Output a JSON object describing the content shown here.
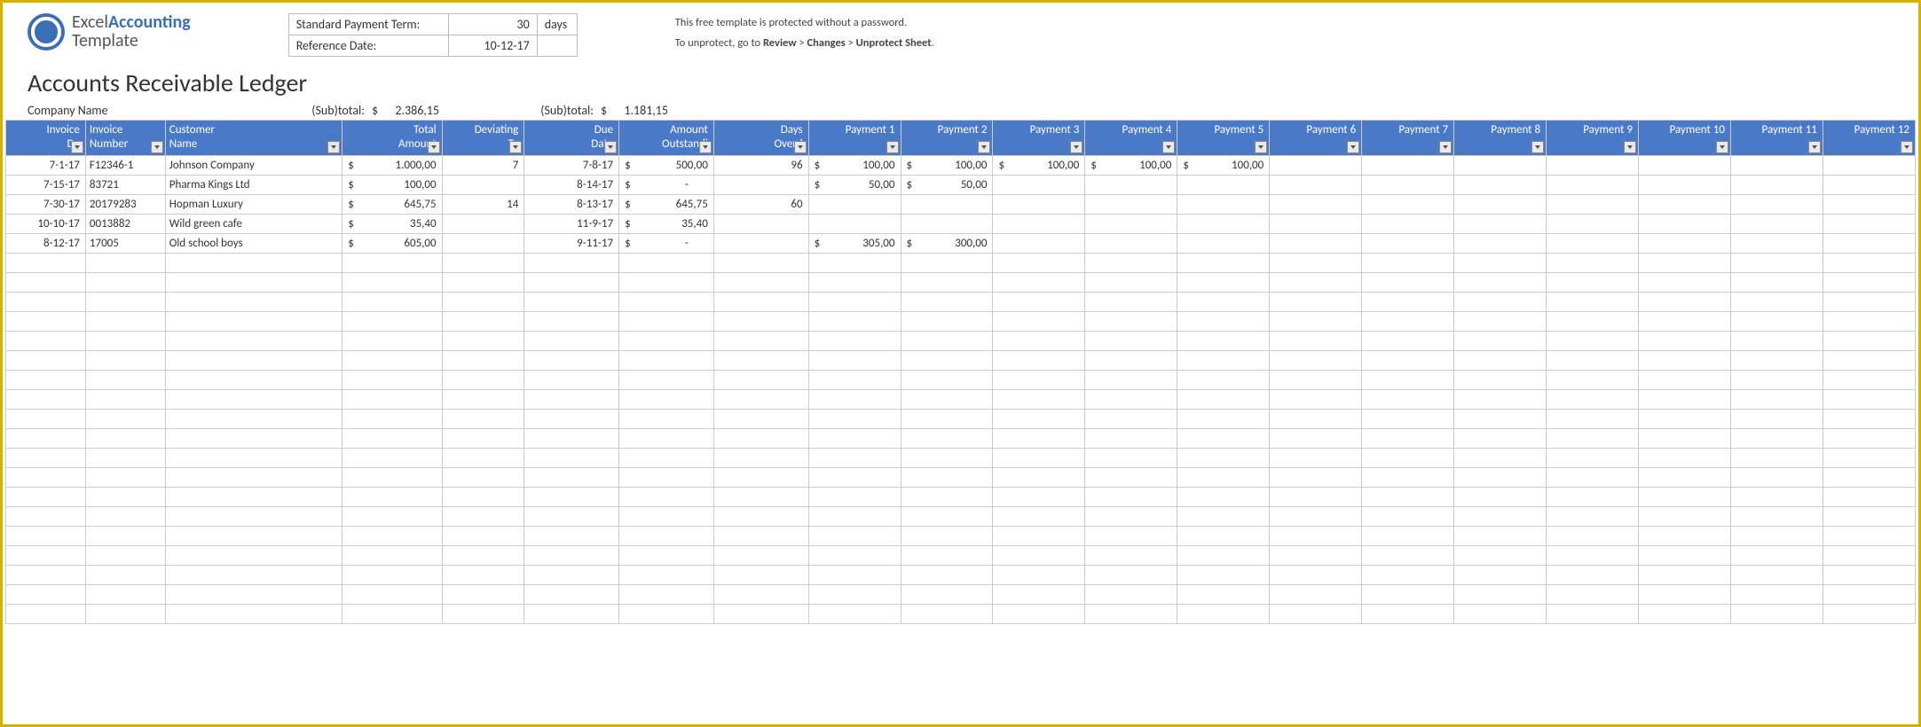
{
  "logo": {
    "line1a": "Excel",
    "line1b": "Accounting",
    "line2": "Template"
  },
  "params": {
    "term_label": "Standard Payment Term:",
    "term_value": "30",
    "term_unit": "days",
    "ref_label": "Reference Date:",
    "ref_value": "10-12-17"
  },
  "notice": {
    "line1": "This free template is protected without a password.",
    "line2a": "To unprotect, go to ",
    "b1": "Review",
    "sep": " > ",
    "b2": "Changes",
    "b3": "Unprotect Sheet",
    "period": "."
  },
  "title": "Accounts Receivable Ledger",
  "subtotals": {
    "company_label": "Company Name",
    "label1": "(Sub)total:",
    "cur1": "$",
    "val1": "2.386,15",
    "label2": "(Sub)total:",
    "cur2": "$",
    "val2": "1.181,15"
  },
  "columns": [
    "Invoice Da",
    "Invoice Number",
    "Customer Name",
    "Total Amount",
    "Deviating Te",
    "Due Date",
    "Amount Outstandi",
    "Days Overd",
    "Payment 1",
    "Payment 2",
    "Payment 3",
    "Payment 4",
    "Payment 5",
    "Payment 6",
    "Payment 7",
    "Payment 8",
    "Payment 9",
    "Payment 10",
    "Payment 11",
    "Payment 12"
  ],
  "currency": "$",
  "rows": [
    {
      "inv_date": "7-1-17",
      "inv_num": "F12346-1",
      "customer": "Johnson Company",
      "total": "1.000,00",
      "dev": "7",
      "due": "7-8-17",
      "amt_out": "500,00",
      "overdue": "96",
      "payments": [
        "100,00",
        "100,00",
        "100,00",
        "100,00",
        "100,00",
        "",
        "",
        "",
        "",
        "",
        "",
        ""
      ]
    },
    {
      "inv_date": "7-15-17",
      "inv_num": "83721",
      "customer": "Pharma Kings Ltd",
      "total": "100,00",
      "dev": "",
      "due": "8-14-17",
      "amt_out": "-",
      "overdue": "",
      "payments": [
        "50,00",
        "50,00",
        "",
        "",
        "",
        "",
        "",
        "",
        "",
        "",
        "",
        ""
      ]
    },
    {
      "inv_date": "7-30-17",
      "inv_num": "20179283",
      "customer": "Hopman Luxury",
      "total": "645,75",
      "dev": "14",
      "due": "8-13-17",
      "amt_out": "645,75",
      "overdue": "60",
      "payments": [
        "",
        "",
        "",
        "",
        "",
        "",
        "",
        "",
        "",
        "",
        "",
        ""
      ]
    },
    {
      "inv_date": "10-10-17",
      "inv_num": "0013882",
      "customer": "Wild green cafe",
      "total": "35,40",
      "dev": "",
      "due": "11-9-17",
      "amt_out": "35,40",
      "overdue": "",
      "payments": [
        "",
        "",
        "",
        "",
        "",
        "",
        "",
        "",
        "",
        "",
        "",
        ""
      ]
    },
    {
      "inv_date": "8-12-17",
      "inv_num": "17005",
      "customer": "Old school boys",
      "total": "605,00",
      "dev": "",
      "due": "9-11-17",
      "amt_out": "-",
      "overdue": "",
      "payments": [
        "305,00",
        "300,00",
        "",
        "",
        "",
        "",
        "",
        "",
        "",
        "",
        "",
        ""
      ]
    }
  ],
  "empty_rows": 19
}
